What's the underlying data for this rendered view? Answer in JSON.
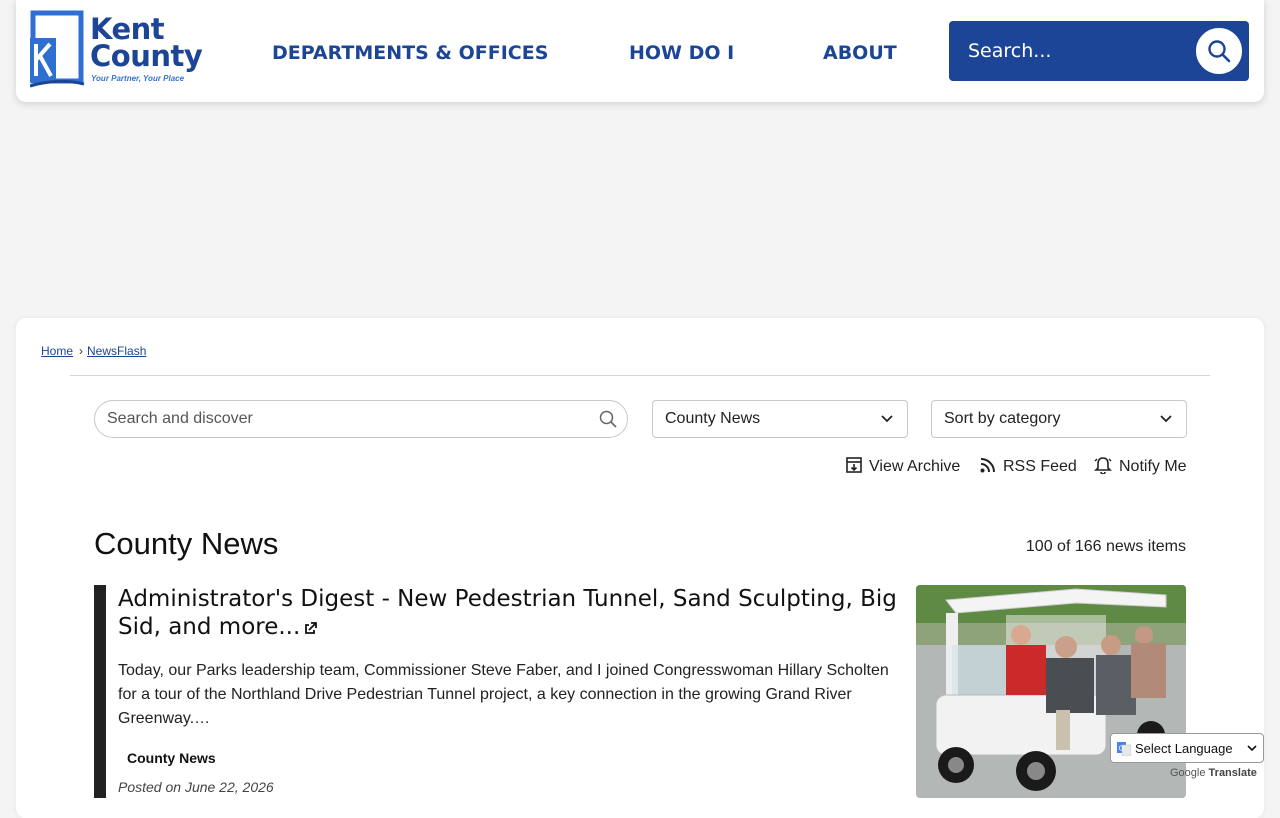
{
  "header": {
    "logo": {
      "line1": "Kent",
      "line2": "County",
      "tagline": "Your Partner, Your Place"
    },
    "nav": [
      {
        "label": "DEPARTMENTS & OFFICES"
      },
      {
        "label": "HOW DO I"
      },
      {
        "label": "ABOUT"
      }
    ],
    "search": {
      "placeholder": "Search..."
    },
    "colors": {
      "brand": "#1c4497"
    }
  },
  "breadcrumb": {
    "home": "Home",
    "separator": "›",
    "current": "NewsFlash"
  },
  "filters": {
    "search_placeholder": "Search and discover",
    "category_value": "County News",
    "sort_value": "Sort by category"
  },
  "actions": {
    "archive": "View Archive",
    "rss": "RSS Feed",
    "notify": "Notify Me"
  },
  "section": {
    "title": "County News",
    "count": "100 of 166 news items"
  },
  "article": {
    "title": "Administrator's Digest - New Pedestrian Tunnel, Sand Sculpting, Big Sid, and more...",
    "summary": "Today, our Parks leadership team, Commissioner Steve Faber, and I joined Congresswoman Hillary Scholten for a tour of the Northland Drive Pedestrian Tunnel project, a key connection in the growing Grand River Greenway.…",
    "category": "County News",
    "posted": "Posted on June 22, 2026"
  },
  "translate": {
    "label": "Select Language",
    "powered_prefix": "Google",
    "powered_suffix": "Translate"
  }
}
